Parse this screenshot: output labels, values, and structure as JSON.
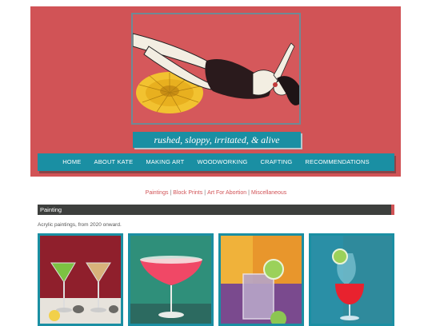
{
  "site": {
    "tagline": "rushed, sloppy, irritated, & alive"
  },
  "nav": {
    "items": [
      "HOME",
      "ABOUT KATE",
      "MAKING ART",
      "WOODWORKING",
      "CRAFTING",
      "RECOMMENDATIONS"
    ]
  },
  "categories": [
    "Paintings",
    "Block Prints",
    "Art For Abortion",
    "Miscellaneous"
  ],
  "section": {
    "title": "Painting",
    "description": "Acrylic paintings, from 2020 onward."
  },
  "colors": {
    "header_bg": "#d15356",
    "accent_teal": "#1a8fa3",
    "section_bar": "#3d3f3d"
  }
}
